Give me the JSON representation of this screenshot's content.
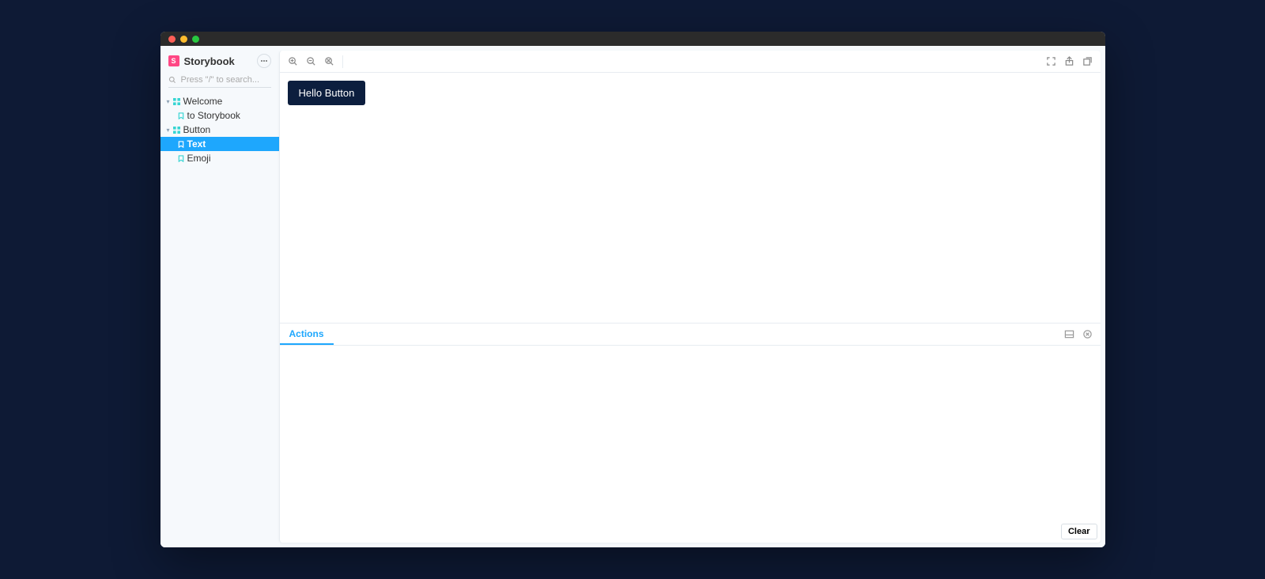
{
  "brand": {
    "title": "Storybook",
    "logo_letter": "S"
  },
  "search": {
    "placeholder": "Press \"/\" to search..."
  },
  "sidebar": {
    "groups": [
      {
        "label": "Welcome",
        "expanded": true,
        "stories": [
          {
            "label": "to Storybook",
            "selected": false
          }
        ]
      },
      {
        "label": "Button",
        "expanded": true,
        "stories": [
          {
            "label": "Text",
            "selected": true
          },
          {
            "label": "Emoji",
            "selected": false
          }
        ]
      }
    ]
  },
  "canvas": {
    "button_label": "Hello Button"
  },
  "addons": {
    "tabs": [
      {
        "label": "Actions",
        "active": true
      }
    ],
    "clear_label": "Clear"
  },
  "icons": {
    "zoom_in": "zoom-in-icon",
    "zoom_out": "zoom-out-icon",
    "zoom_reset": "zoom-reset-icon",
    "fullscreen": "fullscreen-icon",
    "share": "share-icon",
    "open_external": "open-external-icon",
    "panel_position": "panel-position-icon",
    "close_panel": "close-panel-icon"
  }
}
